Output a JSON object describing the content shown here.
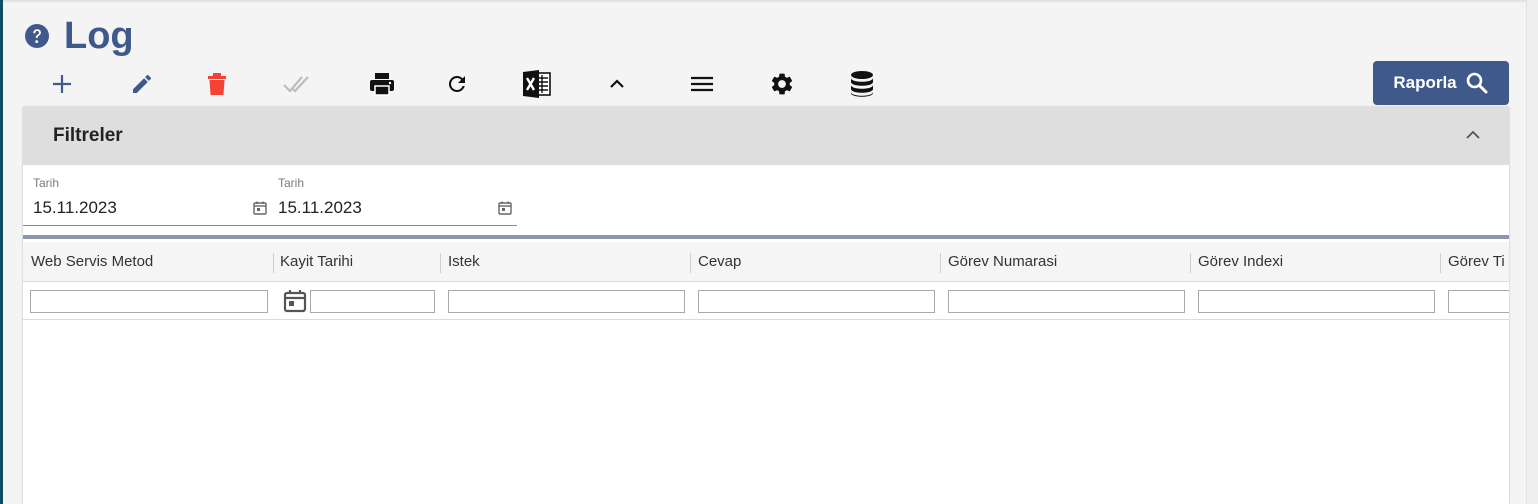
{
  "page": {
    "title": "Log"
  },
  "icons": {
    "help": "help-circle-icon",
    "add": "plus-icon",
    "edit": "pencil-icon",
    "delete": "trash-icon",
    "approve": "double-check-icon",
    "print": "printer-icon",
    "refresh": "refresh-icon",
    "excel": "excel-icon",
    "collapse": "chevron-up-icon",
    "menu": "hamburger-menu-icon",
    "settings": "gear-icon",
    "database": "database-icon",
    "search": "search-icon",
    "calendar": "calendar-icon"
  },
  "colors": {
    "primary": "#3f5a8a",
    "delete": "#f44336",
    "disabled": "#bdbdbd",
    "filter_header_bg": "#dedede",
    "side_bar": "#0d4f63"
  },
  "toolbar": {
    "report_button_label": "Raporla"
  },
  "filters": {
    "title": "Filtreler",
    "fields": [
      {
        "label": "Tarih",
        "value": "15.11.2023"
      },
      {
        "label": "Tarih",
        "value": "15.11.2023"
      }
    ]
  },
  "grid": {
    "columns": [
      "Web Servis Metod",
      "Kayit Tarihi",
      "Istek",
      "Cevap",
      "Görev Numarasi",
      "Görev Indexi",
      "Görev Ti"
    ]
  }
}
